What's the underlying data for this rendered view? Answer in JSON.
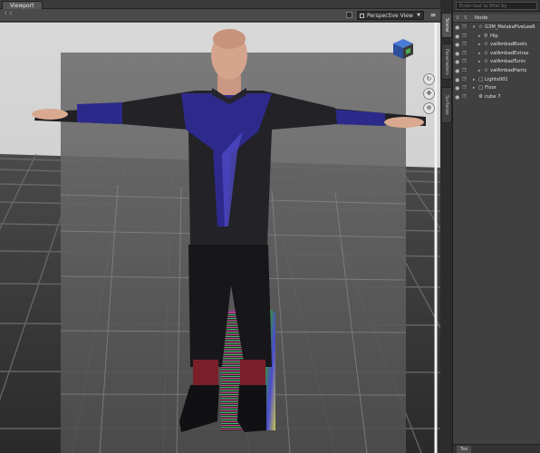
{
  "viewport": {
    "tab_label": "Viewport",
    "corner_label": "↥ ↕",
    "view_select": "Perspective View",
    "options_icon": "menu-lines-icon"
  },
  "scene_panel": {
    "filter_placeholder": "Enter text to filter by",
    "header_label": "Node",
    "header_eye": "V",
    "header_lock": "S",
    "nodes": [
      {
        "label": "G3M_MelakaFiveLee6",
        "icon": "☆",
        "arrow": "▾",
        "depth": 0
      },
      {
        "label": "Hip",
        "icon": "⚲",
        "arrow": "▸",
        "depth": 1
      },
      {
        "label": "valAmbadBoots",
        "icon": "☆",
        "arrow": "▸",
        "depth": 1
      },
      {
        "label": "valAmbadExtras",
        "icon": "☆",
        "arrow": "▸",
        "depth": 1
      },
      {
        "label": "valAmbadTunic",
        "icon": "☆",
        "arrow": "▸",
        "depth": 1
      },
      {
        "label": "valAmbadPants",
        "icon": "☆",
        "arrow": "▸",
        "depth": 1
      },
      {
        "label": "Lights001",
        "icon": "▢",
        "arrow": "▸",
        "depth": 0
      },
      {
        "label": "Floor",
        "icon": "▢",
        "arrow": "▸",
        "depth": 0
      },
      {
        "label": "cube 7",
        "icon": "⚙",
        "arrow": "",
        "depth": 0
      }
    ],
    "bottom_tab": "Tex"
  },
  "side_tabs": [
    "Scene",
    "Parameters",
    "Surfaces"
  ],
  "colors": {
    "panel_bg": "#404040",
    "viewport_bg": "#555555",
    "tunic_accent": "#2e2a8c"
  }
}
